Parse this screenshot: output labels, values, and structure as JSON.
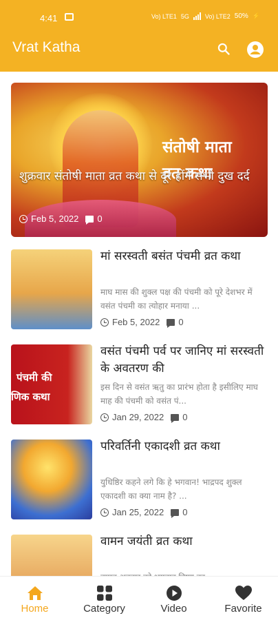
{
  "status_bar": {
    "time": "4:41",
    "right_text": "50%",
    "network_labels": [
      "Vo) LTE1",
      "5G",
      "Vo) LTE2"
    ]
  },
  "app_bar": {
    "title": "Vrat Katha",
    "icons": [
      "search-icon",
      "account-icon"
    ],
    "background_color": "#f4b223"
  },
  "hero": {
    "banner_text_line1": "संतोषी माता",
    "banner_text_line2": "व्रत कथा",
    "caption": "शुक्रवार संतोषी माता व्रत कथा से दूर होंगे सभी दुख दर्द",
    "date": "Feb 5, 2022",
    "comments": "0"
  },
  "articles": [
    {
      "title": "मां सरस्वती बसंत पंचमी व्रत कथा",
      "excerpt": "माघ मास की शुक्ल पक्ष की पंचमी को पूरे देशभर में वसंत पंचमी का त्योहार मनाया ...",
      "date": "Feb 5, 2022",
      "comments": "0"
    },
    {
      "title": "वसंत पंचमी पर्व पर जानिए मां सरस्वती के अवतरण की",
      "excerpt": "इस दिन से वसंत ऋतु का प्रारंभ होता है इसीलिए माघ माह की पंचमी को वसंत पं...",
      "date": "Jan 29, 2022",
      "comments": "0",
      "thumb_text_1": "पंचमी की",
      "thumb_text_2": "णिक कथा"
    },
    {
      "title": "परिवर्तिनी एकादशी व्रत कथा",
      "excerpt": "युधिष्ठिर कहने लगे कि हे भगवान! भाद्रपद शुक्ल एकादशी का क्या नाम है? ...",
      "date": "Jan 25, 2022",
      "comments": "0"
    },
    {
      "title": "वामन जयंती व्रत कथा",
      "excerpt": "वामन अवतार को भगवान विष्णु का",
      "date": "",
      "comments": ""
    }
  ],
  "bottom_nav": [
    {
      "label": "Home",
      "icon": "home-icon",
      "active": true
    },
    {
      "label": "Category",
      "icon": "category-icon",
      "active": false
    },
    {
      "label": "Video",
      "icon": "play-circle-icon",
      "active": false
    },
    {
      "label": "Favorite",
      "icon": "heart-icon",
      "active": false
    }
  ],
  "colors": {
    "accent": "#f4a71d",
    "text": "#222222",
    "muted": "#888888"
  }
}
